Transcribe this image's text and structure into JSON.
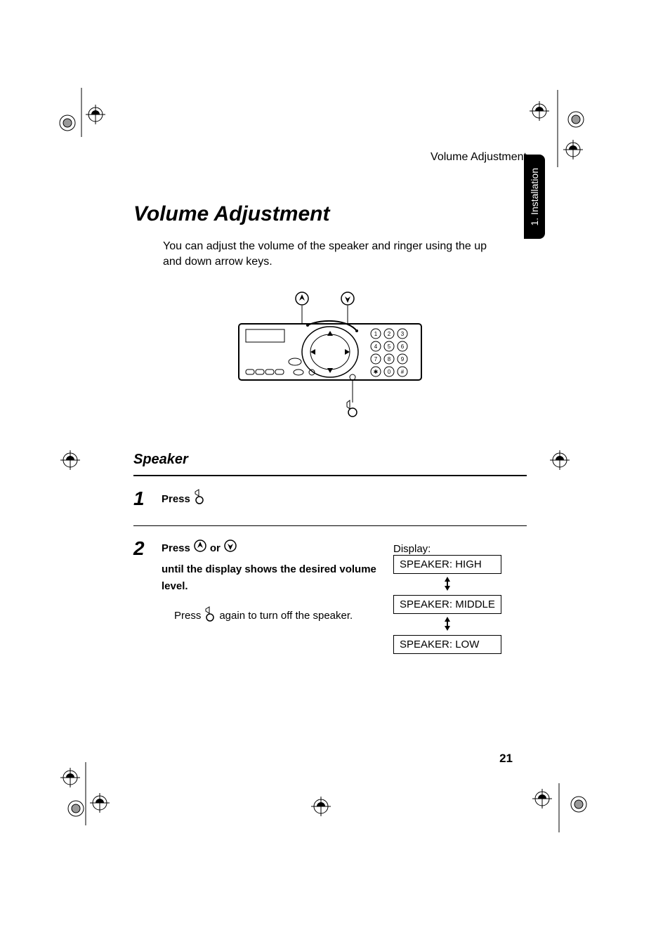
{
  "header": {
    "running": "Volume Adjustment"
  },
  "tab": {
    "label": "1. Installation"
  },
  "title": "Volume Adjustment",
  "intro": "You can adjust the volume of the speaker and ringer using the up and down arrow keys.",
  "subhead": "Speaker",
  "keypad": [
    "1",
    "2",
    "3",
    "4",
    "5",
    "6",
    "7",
    "8",
    "9",
    "✱",
    "0",
    "#"
  ],
  "steps": {
    "s1": {
      "num": "1",
      "lead": "Press"
    },
    "s2": {
      "num": "2",
      "lead1": "Press",
      "mid": "or",
      "lead2": "until the display shows the desired volume level.",
      "sub_a": "Press",
      "sub_b": "again to turn off the speaker.",
      "display_label": "Display:",
      "levels": [
        "SPEAKER: HIGH",
        "SPEAKER: MIDDLE",
        "SPEAKER: LOW"
      ]
    }
  },
  "page_number": "21"
}
